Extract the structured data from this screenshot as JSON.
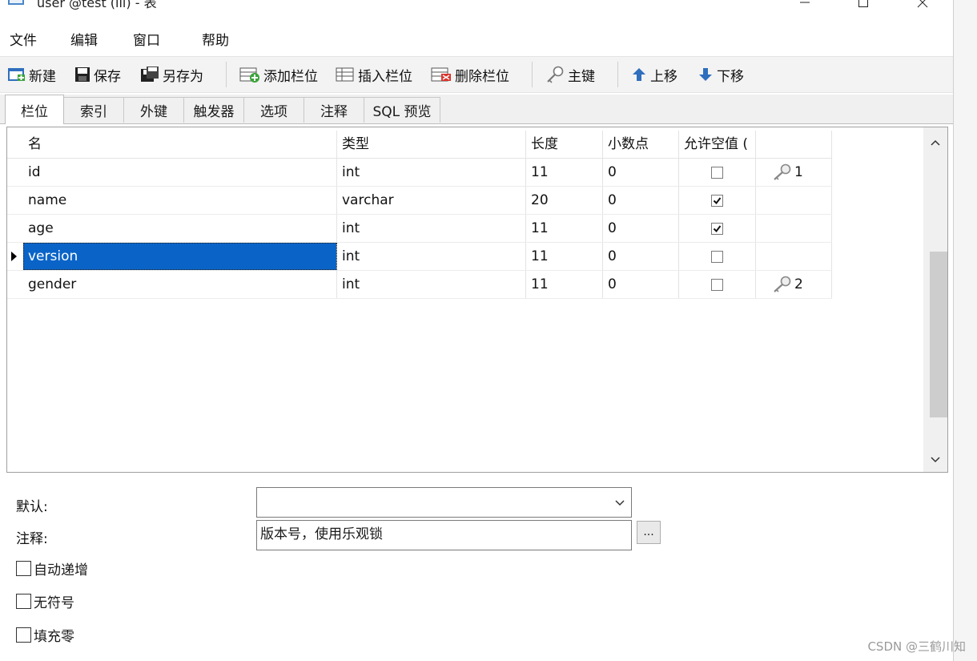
{
  "window": {
    "title": "user @test (lll) - 表",
    "controls": [
      "minimize-icon",
      "maximize-icon",
      "close-icon"
    ]
  },
  "menu": [
    "文件",
    "编辑",
    "窗口",
    "帮助"
  ],
  "toolbar": {
    "new": "新建",
    "save": "保存",
    "save_as": "另存为",
    "add_field": "添加栏位",
    "insert_field": "插入栏位",
    "delete_field": "删除栏位",
    "primary_key": "主键",
    "move_up": "上移",
    "move_down": "下移"
  },
  "tabs": [
    "栏位",
    "索引",
    "外键",
    "触发器",
    "选项",
    "注释",
    "SQL 预览"
  ],
  "grid": {
    "headers": [
      "名",
      "类型",
      "长度",
      "小数点",
      "允许空值 (",
      ""
    ],
    "rows": [
      {
        "name": "id",
        "type": "int",
        "length": "11",
        "decimals": "0",
        "nullable": false,
        "key": "1"
      },
      {
        "name": "name",
        "type": "varchar",
        "length": "20",
        "decimals": "0",
        "nullable": true,
        "key": ""
      },
      {
        "name": "age",
        "type": "int",
        "length": "11",
        "decimals": "0",
        "nullable": true,
        "key": ""
      },
      {
        "name": "version",
        "type": "int",
        "length": "11",
        "decimals": "0",
        "nullable": false,
        "key": ""
      },
      {
        "name": "gender",
        "type": "int",
        "length": "11",
        "decimals": "0",
        "nullable": false,
        "key": "2"
      }
    ],
    "selected_row": 3
  },
  "properties": {
    "default_label": "默认:",
    "default_value": "",
    "comment_label": "注释:",
    "comment_value": "版本号，使用乐观锁",
    "ellipsis": "...",
    "auto_increment": "自动递增",
    "unsigned": "无符号",
    "zerofill": "填充零"
  },
  "watermark": "CSDN @三鹤川知"
}
